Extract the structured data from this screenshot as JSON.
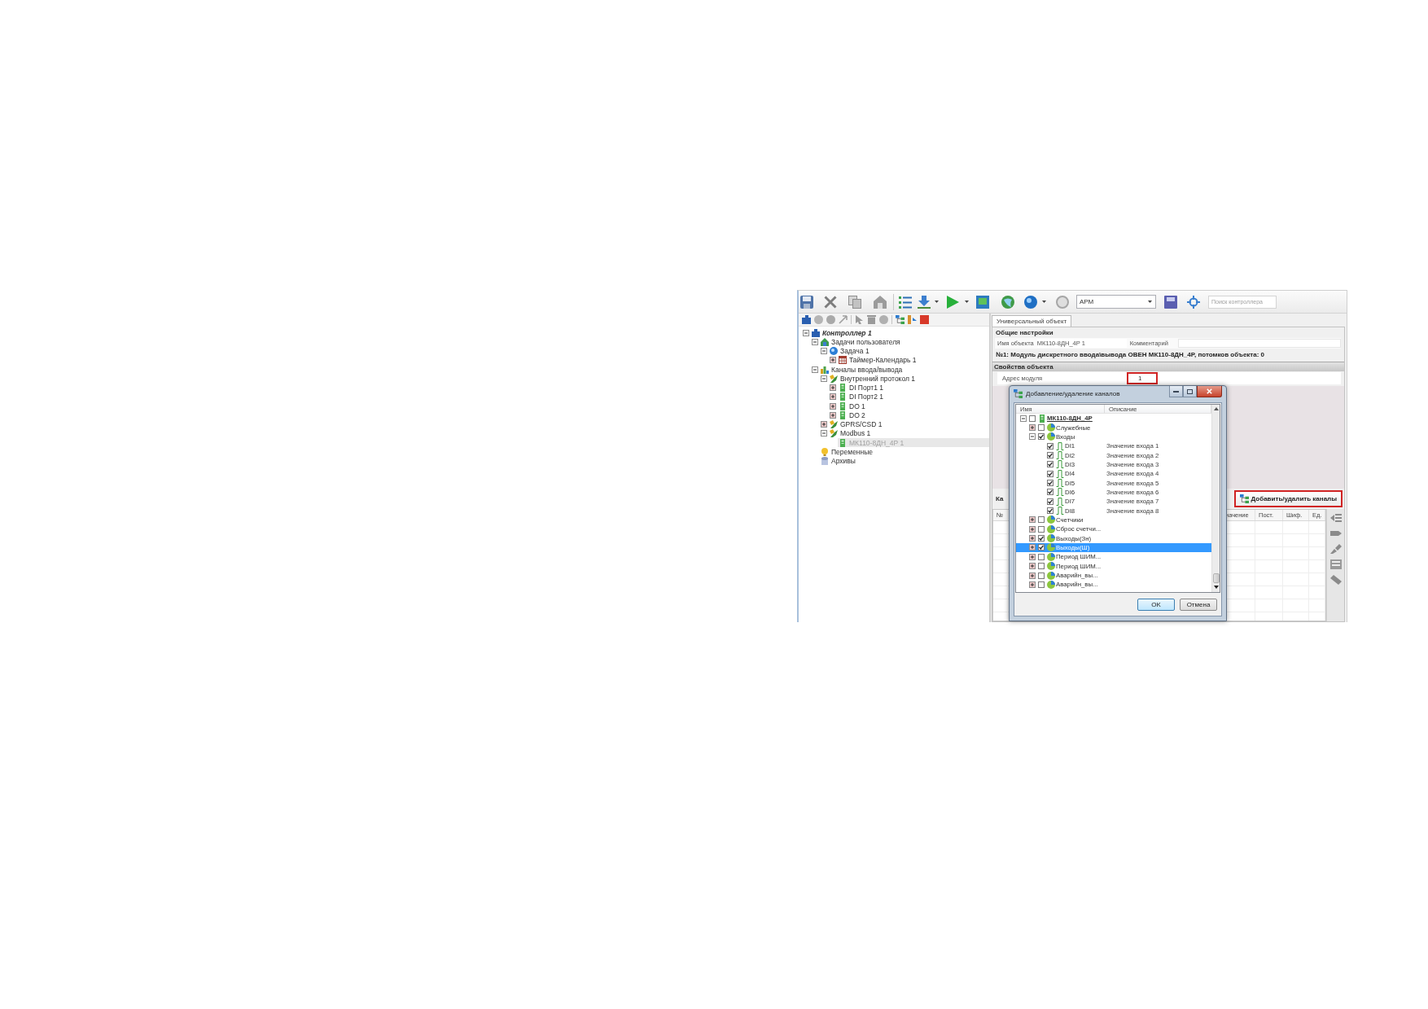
{
  "toolbar": {
    "profile_select": {
      "value": "АРМ"
    },
    "search": {
      "placeholder": "Поиск контроллера"
    }
  },
  "project_tree": {
    "items": [
      {
        "label": "Контроллер 1",
        "kind": "controller",
        "expanded": true,
        "selected": false,
        "children": [
          {
            "label": "Задачи пользователя",
            "kind": "tasks",
            "expanded": true,
            "selected": false,
            "children": [
              {
                "label": "Задача 1",
                "kind": "task",
                "expanded": true,
                "selected": false,
                "children": [
                  {
                    "label": "Таймер-Календарь 1",
                    "kind": "calendar",
                    "expanded": false,
                    "selected": false
                  }
                ]
              }
            ]
          },
          {
            "label": "Каналы ввода/вывода",
            "kind": "channels",
            "expanded": true,
            "selected": false,
            "children": [
              {
                "label": "Внутренний протокол 1",
                "kind": "protocol",
                "expanded": true,
                "selected": false,
                "children": [
                  {
                    "label": "DI Порт1 1",
                    "kind": "module",
                    "expanded": false,
                    "selected": false
                  },
                  {
                    "label": "DI Порт2 1",
                    "kind": "module",
                    "expanded": false,
                    "selected": false
                  },
                  {
                    "label": "DO 1",
                    "kind": "module",
                    "expanded": false,
                    "selected": false
                  },
                  {
                    "label": "DO 2",
                    "kind": "module",
                    "expanded": false,
                    "selected": false
                  }
                ]
              },
              {
                "label": "GPRS/CSD 1",
                "kind": "protocol",
                "expanded": false,
                "selected": false
              },
              {
                "label": "Modbus 1",
                "kind": "protocol",
                "expanded": true,
                "selected": false,
                "children": [
                  {
                    "label": "МК110-8ДН_4Р 1",
                    "kind": "module",
                    "selected": true
                  }
                ]
              }
            ]
          },
          {
            "label": "Переменные",
            "kind": "variables",
            "selected": false
          },
          {
            "label": "Архивы",
            "kind": "archives",
            "selected": false
          }
        ]
      }
    ]
  },
  "object_panel": {
    "tabs": [
      {
        "label": "Универсальный объект",
        "selected": true
      }
    ],
    "general": {
      "title": "Общие настройки",
      "name_label": "Имя объекта",
      "name_value": "МК110-8ДН_4Р 1",
      "comment_label": "Комментарий",
      "summary": "№1: Модуль дискретного ввода\\вывода ОВЕН МК110-8ДН_4Р, потомков объекта: 0"
    },
    "properties": {
      "title": "Свойства объекта",
      "rows": [
        {
          "label": "Адрес модуля",
          "value": "1",
          "highlighted": true
        }
      ]
    },
    "channels": {
      "title": "Ка",
      "add_remove_button": {
        "label": "Добавить/удалить каналы",
        "highlighted": true
      },
      "columns": [
        "№",
        "начение",
        "Пост.",
        "Шиф.",
        "Ед."
      ]
    }
  },
  "channel_dialog": {
    "title": "Добавление/удаление каналов",
    "columns": [
      "Имя",
      "Описание"
    ],
    "tree": [
      {
        "label": "МК110-8ДН_4Р",
        "kind": "device",
        "expanded": true,
        "checked": false,
        "selected": false,
        "children": [
          {
            "label": "Служебные",
            "kind": "group",
            "expanded": false,
            "checked": false,
            "selected": false
          },
          {
            "label": "Входы",
            "kind": "group",
            "expanded": true,
            "checked": true,
            "selected": false,
            "children": [
              {
                "label": "DI1",
                "kind": "input",
                "description": "Значение входа 1",
                "checked": true,
                "selected": false
              },
              {
                "label": "DI2",
                "kind": "input",
                "description": "Значение входа 2",
                "checked": true,
                "selected": false
              },
              {
                "label": "DI3",
                "kind": "input",
                "description": "Значение входа 3",
                "checked": true,
                "selected": false
              },
              {
                "label": "DI4",
                "kind": "input",
                "description": "Значение входа 4",
                "checked": true,
                "selected": false
              },
              {
                "label": "DI5",
                "kind": "input",
                "description": "Значение входа 5",
                "checked": true,
                "selected": false
              },
              {
                "label": "DI6",
                "kind": "input",
                "description": "Значение входа 6",
                "checked": true,
                "selected": false
              },
              {
                "label": "DI7",
                "kind": "input",
                "description": "Значение входа 7",
                "checked": true,
                "selected": false
              },
              {
                "label": "DI8",
                "kind": "input",
                "description": "Значение входа 8",
                "checked": true,
                "selected": false
              }
            ]
          },
          {
            "label": "Счетчики",
            "kind": "group",
            "expanded": false,
            "checked": false,
            "selected": false
          },
          {
            "label": "Сброс счетчи...",
            "kind": "group",
            "expanded": false,
            "checked": false,
            "selected": false
          },
          {
            "label": "Выходы(Зн)",
            "kind": "group",
            "expanded": false,
            "checked": true,
            "selected": false
          },
          {
            "label": "Выходы(Ш)",
            "kind": "group",
            "expanded": false,
            "checked": true,
            "selected": true
          },
          {
            "label": "Период ШИМ...",
            "kind": "group",
            "expanded": false,
            "checked": false,
            "selected": false
          },
          {
            "label": "Период ШИМ...",
            "kind": "group",
            "expanded": false,
            "checked": false,
            "selected": false
          },
          {
            "label": "Аварийн_вы...",
            "kind": "group",
            "expanded": false,
            "checked": false,
            "selected": false
          },
          {
            "label": "Аварийн_вы...",
            "kind": "group",
            "expanded": false,
            "checked": false,
            "selected": false
          }
        ]
      }
    ],
    "buttons": [
      {
        "label": "OK",
        "default": true
      },
      {
        "label": "Отмена",
        "default": false
      }
    ]
  }
}
